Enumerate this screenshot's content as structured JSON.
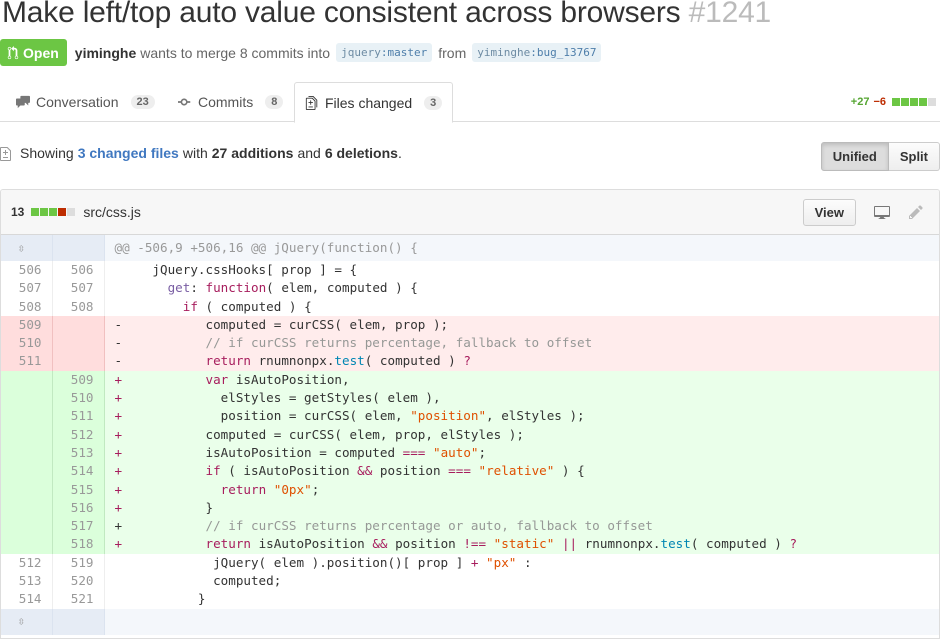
{
  "pr": {
    "title": "Make left/top auto value consistent across browsers",
    "number": "#1241",
    "state": "Open",
    "author": "yiminghe",
    "merge_text": "wants to merge 8 commits into",
    "base_user": "jquery",
    "base_branch": "master",
    "from_text": "from",
    "head_user": "yiminghe",
    "head_branch": "bug_13767"
  },
  "tabs": [
    {
      "label": "Conversation",
      "count": "23"
    },
    {
      "label": "Commits",
      "count": "8"
    },
    {
      "label": "Files changed",
      "count": "3"
    }
  ],
  "diffstat": {
    "additions": "+27",
    "deletions": "−6"
  },
  "summary": {
    "prefix": "Showing",
    "files_link": "3 changed files",
    "with": "with",
    "additions": "27 additions",
    "and": "and",
    "deletions": "6 deletions",
    "end": "."
  },
  "view_toggle": {
    "unified": "Unified",
    "split": "Split"
  },
  "file": {
    "changes": "13",
    "path": "src/css.js",
    "view_label": "View",
    "hunk_header": "@@ -506,9 +506,16 @@ jQuery(function() {",
    "lines": [
      {
        "type": "ctx",
        "old": "506",
        "new": "506",
        "text": "     jQuery.cssHooks[ prop ] = {"
      },
      {
        "type": "ctx",
        "old": "507",
        "new": "507",
        "text": "       get: function( elem, computed ) {"
      },
      {
        "type": "ctx",
        "old": "508",
        "new": "508",
        "text": "         if ( computed ) {"
      },
      {
        "type": "del",
        "old": "509",
        "new": "",
        "text": "-           computed = curCSS( elem, prop );"
      },
      {
        "type": "del",
        "old": "510",
        "new": "",
        "text": "-           // if curCSS returns percentage, fallback to offset"
      },
      {
        "type": "del",
        "old": "511",
        "new": "",
        "text": "-           return rnumnonpx.test( computed ) ?"
      },
      {
        "type": "add",
        "old": "",
        "new": "509",
        "text": "+           var isAutoPosition,"
      },
      {
        "type": "add",
        "old": "",
        "new": "510",
        "text": "+             elStyles = getStyles( elem ),"
      },
      {
        "type": "add",
        "old": "",
        "new": "511",
        "text": "+             position = curCSS( elem, \"position\", elStyles );"
      },
      {
        "type": "add",
        "old": "",
        "new": "512",
        "text": "+           computed = curCSS( elem, prop, elStyles );"
      },
      {
        "type": "add",
        "old": "",
        "new": "513",
        "text": "+           isAutoPosition = computed === \"auto\";"
      },
      {
        "type": "add",
        "old": "",
        "new": "514",
        "text": "+           if ( isAutoPosition && position === \"relative\" ) {"
      },
      {
        "type": "add",
        "old": "",
        "new": "515",
        "text": "+             return \"0px\";"
      },
      {
        "type": "add",
        "old": "",
        "new": "516",
        "text": "+           }"
      },
      {
        "type": "add",
        "old": "",
        "new": "517",
        "text": "+           // if curCSS returns percentage or auto, fallback to offset"
      },
      {
        "type": "add",
        "old": "",
        "new": "518",
        "text": "+           return isAutoPosition && position !== \"static\" || rnumnonpx.test( computed ) ?"
      },
      {
        "type": "ctx",
        "old": "512",
        "new": "519",
        "text": "             jQuery( elem ).position()[ prop ] + \"px\" :"
      },
      {
        "type": "ctx",
        "old": "513",
        "new": "520",
        "text": "             computed;"
      },
      {
        "type": "ctx",
        "old": "514",
        "new": "521",
        "text": "           }"
      }
    ]
  },
  "icons": {
    "state": "git-pull-request-icon",
    "conversation": "comment-discussion-icon",
    "commits": "git-commit-icon",
    "files": "diff-icon",
    "expand": "unfold-icon",
    "display": "device-desktop-icon",
    "edit": "pencil-icon"
  },
  "colors": {
    "open": "#6cc644",
    "add_bg": "#eaffea",
    "del_bg": "#ffecec",
    "link": "#4078c0"
  }
}
